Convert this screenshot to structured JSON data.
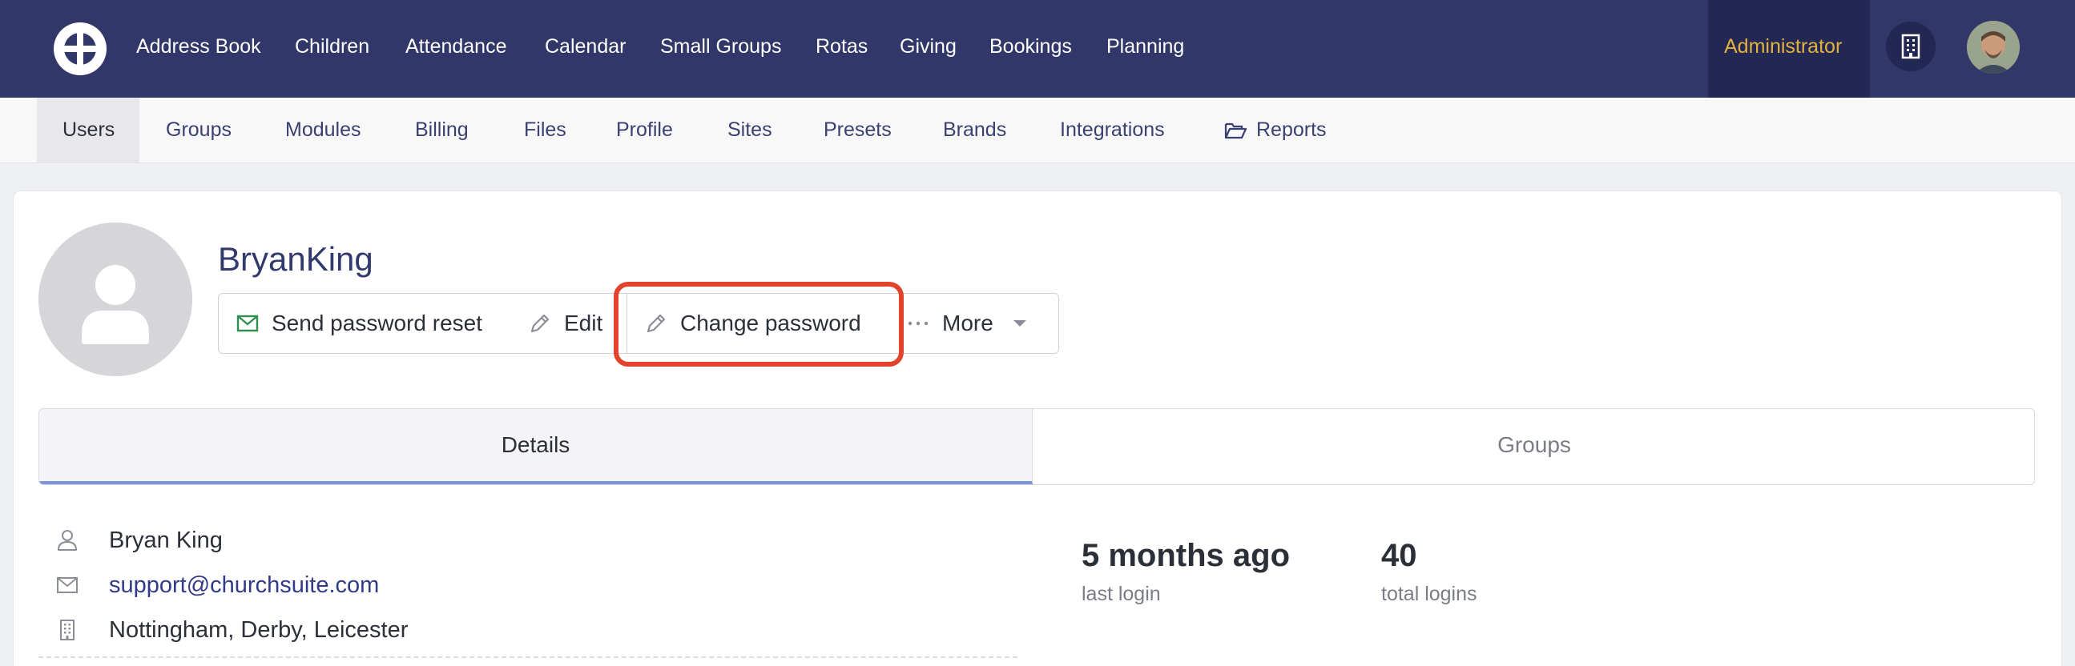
{
  "topnav": {
    "items": [
      "Address Book",
      "Children",
      "Attendance",
      "Calendar",
      "Small Groups",
      "Rotas",
      "Giving",
      "Bookings",
      "Planning"
    ],
    "admin_label": "Administrator",
    "colors": {
      "background": "#313768",
      "admin_background": "#222853",
      "admin_text": "#e3b23c"
    }
  },
  "subnav": {
    "items": [
      "Users",
      "Groups",
      "Modules",
      "Billing",
      "Files",
      "Profile",
      "Sites",
      "Presets",
      "Brands",
      "Integrations",
      "Reports"
    ],
    "active": "Users",
    "reports_icon": "folder-open-icon"
  },
  "user": {
    "name": "BryanKing"
  },
  "actions": {
    "send_reset": "Send password reset",
    "edit": "Edit",
    "change_password": "Change password",
    "more": "More",
    "highlight_color": "#e2432a"
  },
  "tabs": {
    "details": "Details",
    "groups": "Groups"
  },
  "details": {
    "full_name": "Bryan King",
    "email": "support@churchsuite.com",
    "sites": "Nottingham, Derby, Leicester"
  },
  "stats": {
    "last_login_value": "5 months ago",
    "last_login_label": "last login",
    "total_logins_value": "40",
    "total_logins_label": "total logins"
  }
}
